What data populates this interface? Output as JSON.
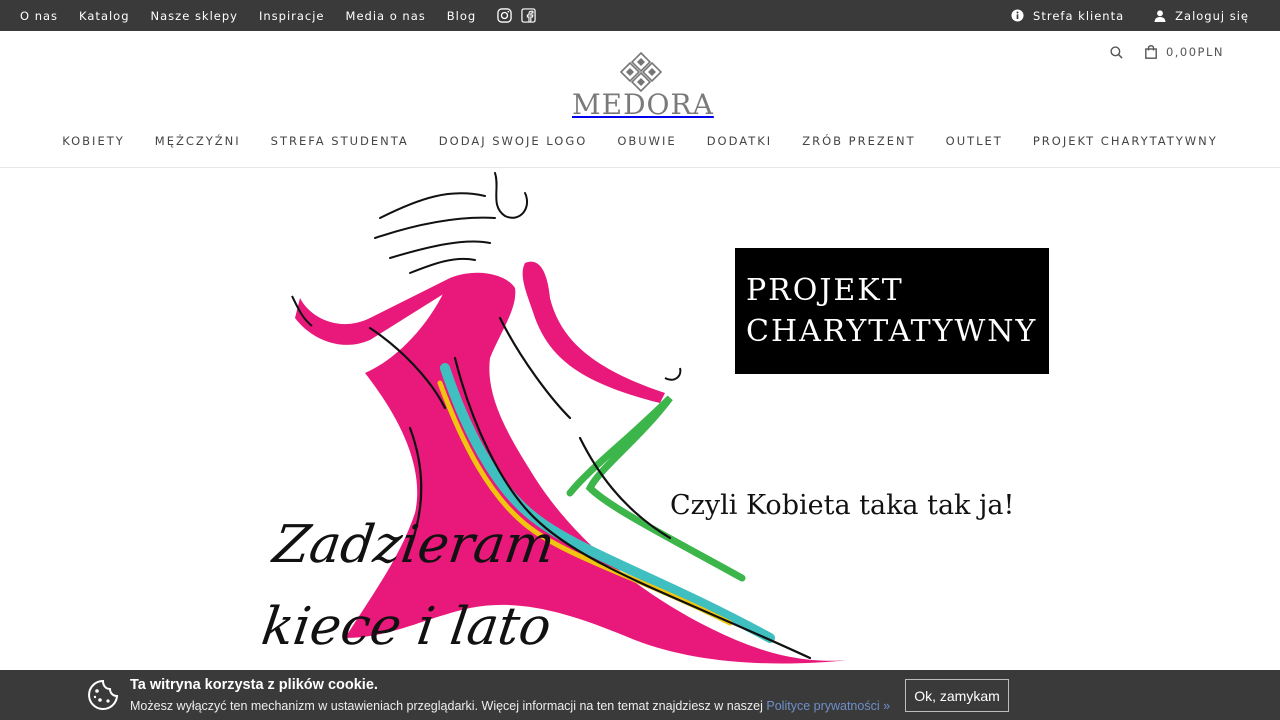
{
  "topbar": {
    "links": [
      "O nas",
      "Katalog",
      "Nasze sklepy",
      "Inspiracje",
      "Media o nas",
      "Blog"
    ],
    "social_icons": [
      "instagram-icon",
      "facebook-icon"
    ],
    "client_zone": "Strefa klienta",
    "login": "Zaloguj się"
  },
  "header": {
    "logo_text": "MEDORA",
    "cart_total": "0,00PLN"
  },
  "nav": {
    "items": [
      "KOBIETY",
      "MĘŻCZYŹNI",
      "STREFA STUDENTA",
      "DODAJ SWOJE LOGO",
      "OBUWIE",
      "DODATKI",
      "ZRÓB PREZENT",
      "OUTLET",
      "PROJEKT CHARYTATYWNY"
    ]
  },
  "hero": {
    "badge_line1": "PROJEKT",
    "badge_line2": "CHARYTATYWNY",
    "tagline": "Czyli Kobieta taka tak ja!",
    "script_line1": "Zadzieram",
    "script_line2": "kiece i lato",
    "colors": {
      "dress": "#e8197a",
      "sash_green": "#3cb54a",
      "sash_teal": "#3fbfc0",
      "sash_yellow": "#f1c40f"
    }
  },
  "cookie": {
    "title": "Ta witryna korzysta z plików cookie.",
    "message": "Możesz wyłączyć ten mechanizm w ustawieniach przeglądarki. Więcej informacji na ten temat znajdziesz w naszej ",
    "link": "Polityce prywatności »",
    "button": "Ok, zamykam"
  }
}
